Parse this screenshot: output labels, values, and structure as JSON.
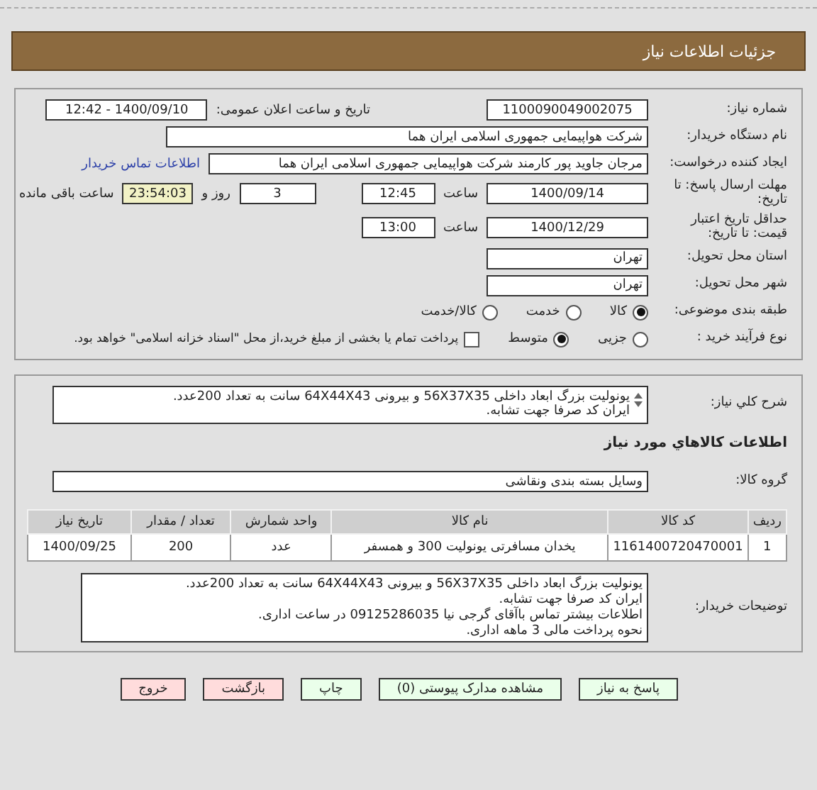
{
  "header": {
    "title": "جزئیات اطلاعات نیاز"
  },
  "need_number": {
    "label": "شماره نیاز:",
    "value": "1100090049002075"
  },
  "announce": {
    "label": "تاریخ و ساعت اعلان عمومی:",
    "value": "1400/09/10 - 12:42"
  },
  "buyer_org": {
    "label": "نام دستگاه خریدار:",
    "value": "شرکت هواپیمایی جمهوری اسلامی ایران هما"
  },
  "requester": {
    "label": "ایجاد کننده درخواست:",
    "value": "مرجان جاوید پور کارمند شرکت هواپیمایی جمهوری اسلامی ایران هما",
    "link": "اطلاعات تماس خریدار"
  },
  "deadline": {
    "label": "مهلت ارسال پاسخ: تا تاریخ:",
    "date": "1400/09/14",
    "time_label": "ساعت",
    "time": "12:45",
    "days": "3",
    "days_label": "روز و",
    "remaining": "23:54:03",
    "remaining_label": "ساعت باقی مانده"
  },
  "validity": {
    "label": "حداقل تاریخ اعتبار قیمت: تا تاریخ:",
    "date": "1400/12/29",
    "time_label": "ساعت",
    "time": "13:00"
  },
  "province": {
    "label": "استان محل تحویل:",
    "value": "تهران"
  },
  "city": {
    "label": "شهر محل تحویل:",
    "value": "تهران"
  },
  "category": {
    "label": "طبقه بندی موضوعی:",
    "options": [
      {
        "label": "کالا",
        "selected": true
      },
      {
        "label": "خدمت",
        "selected": false
      },
      {
        "label": "کالا/خدمت",
        "selected": false
      }
    ]
  },
  "process": {
    "label": "نوع فرآیند خرید :",
    "options": [
      {
        "label": "جزیی",
        "selected": false
      },
      {
        "label": "متوسط",
        "selected": true
      }
    ],
    "treasury": {
      "checked": false,
      "text": "پرداخت تمام یا بخشی از مبلغ خرید،از محل \"اسناد خزانه اسلامی\" خواهد بود."
    }
  },
  "description": {
    "label": "شرح کلي نياز:",
    "lines": [
      "یونولیت بزرگ ابعاد داخلی 56X37X35 و بیرونی 64X44X43 سانت به تعداد 200عدد.",
      "ایران کد صرفا جهت تشابه."
    ]
  },
  "goods_heading": "اطلاعات کالاهاي مورد نياز",
  "goods_group": {
    "label": "گروه کالا:",
    "value": "وسایل بسته بندی  ونقاشی"
  },
  "table": {
    "columns": [
      "ردیف",
      "کد کالا",
      "نام کالا",
      "واحد شمارش",
      "تعداد / مقدار",
      "تاریخ نیاز"
    ],
    "rows": [
      [
        "1",
        "1161400720470001",
        "یخدان مسافرتی یونولیت 300 و همسفر",
        "عدد",
        "200",
        "1400/09/25"
      ]
    ]
  },
  "buyer_notes": {
    "label": "توضیحات خریدار:",
    "lines": [
      "یونولیت بزرگ ابعاد داخلی 56X37X35 و بیرونی 64X44X43 سانت به تعداد 200عدد.",
      "ایران کد صرفا جهت تشابه.",
      "اطلاعات بیشتر تماس باآقای گرجی نیا 09125286035 در ساعت اداری.",
      "نحوه پرداخت مالی 3 ماهه اداری."
    ]
  },
  "buttons": [
    {
      "label": "پاسخ به نیاز",
      "kind": "action"
    },
    {
      "label": "مشاهده مدارک پیوستی (0)",
      "kind": "action"
    },
    {
      "label": "چاپ",
      "kind": "action"
    },
    {
      "label": "بازگشت",
      "kind": "nav"
    },
    {
      "label": "خروج",
      "kind": "nav"
    }
  ]
}
